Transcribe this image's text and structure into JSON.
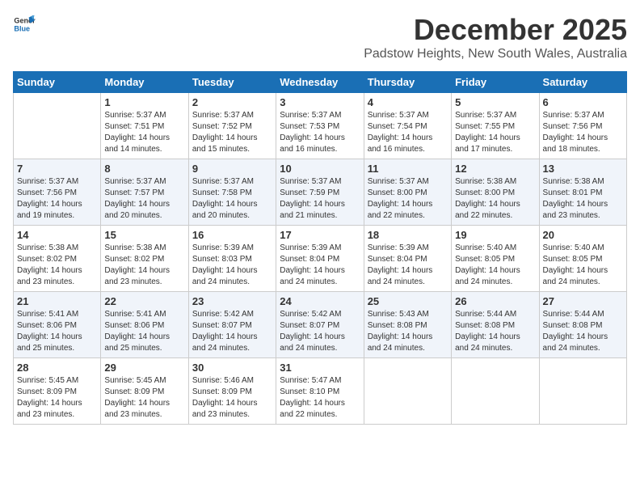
{
  "header": {
    "logo_general": "General",
    "logo_blue": "Blue",
    "title": "December 2025",
    "subtitle": "Padstow Heights, New South Wales, Australia"
  },
  "days_of_week": [
    "Sunday",
    "Monday",
    "Tuesday",
    "Wednesday",
    "Thursday",
    "Friday",
    "Saturday"
  ],
  "weeks": [
    [
      {
        "day": "",
        "info": ""
      },
      {
        "day": "1",
        "info": "Sunrise: 5:37 AM\nSunset: 7:51 PM\nDaylight: 14 hours\nand 14 minutes."
      },
      {
        "day": "2",
        "info": "Sunrise: 5:37 AM\nSunset: 7:52 PM\nDaylight: 14 hours\nand 15 minutes."
      },
      {
        "day": "3",
        "info": "Sunrise: 5:37 AM\nSunset: 7:53 PM\nDaylight: 14 hours\nand 16 minutes."
      },
      {
        "day": "4",
        "info": "Sunrise: 5:37 AM\nSunset: 7:54 PM\nDaylight: 14 hours\nand 16 minutes."
      },
      {
        "day": "5",
        "info": "Sunrise: 5:37 AM\nSunset: 7:55 PM\nDaylight: 14 hours\nand 17 minutes."
      },
      {
        "day": "6",
        "info": "Sunrise: 5:37 AM\nSunset: 7:56 PM\nDaylight: 14 hours\nand 18 minutes."
      }
    ],
    [
      {
        "day": "7",
        "info": "Sunrise: 5:37 AM\nSunset: 7:56 PM\nDaylight: 14 hours\nand 19 minutes."
      },
      {
        "day": "8",
        "info": "Sunrise: 5:37 AM\nSunset: 7:57 PM\nDaylight: 14 hours\nand 20 minutes."
      },
      {
        "day": "9",
        "info": "Sunrise: 5:37 AM\nSunset: 7:58 PM\nDaylight: 14 hours\nand 20 minutes."
      },
      {
        "day": "10",
        "info": "Sunrise: 5:37 AM\nSunset: 7:59 PM\nDaylight: 14 hours\nand 21 minutes."
      },
      {
        "day": "11",
        "info": "Sunrise: 5:37 AM\nSunset: 8:00 PM\nDaylight: 14 hours\nand 22 minutes."
      },
      {
        "day": "12",
        "info": "Sunrise: 5:38 AM\nSunset: 8:00 PM\nDaylight: 14 hours\nand 22 minutes."
      },
      {
        "day": "13",
        "info": "Sunrise: 5:38 AM\nSunset: 8:01 PM\nDaylight: 14 hours\nand 23 minutes."
      }
    ],
    [
      {
        "day": "14",
        "info": "Sunrise: 5:38 AM\nSunset: 8:02 PM\nDaylight: 14 hours\nand 23 minutes."
      },
      {
        "day": "15",
        "info": "Sunrise: 5:38 AM\nSunset: 8:02 PM\nDaylight: 14 hours\nand 23 minutes."
      },
      {
        "day": "16",
        "info": "Sunrise: 5:39 AM\nSunset: 8:03 PM\nDaylight: 14 hours\nand 24 minutes."
      },
      {
        "day": "17",
        "info": "Sunrise: 5:39 AM\nSunset: 8:04 PM\nDaylight: 14 hours\nand 24 minutes."
      },
      {
        "day": "18",
        "info": "Sunrise: 5:39 AM\nSunset: 8:04 PM\nDaylight: 14 hours\nand 24 minutes."
      },
      {
        "day": "19",
        "info": "Sunrise: 5:40 AM\nSunset: 8:05 PM\nDaylight: 14 hours\nand 24 minutes."
      },
      {
        "day": "20",
        "info": "Sunrise: 5:40 AM\nSunset: 8:05 PM\nDaylight: 14 hours\nand 24 minutes."
      }
    ],
    [
      {
        "day": "21",
        "info": "Sunrise: 5:41 AM\nSunset: 8:06 PM\nDaylight: 14 hours\nand 25 minutes."
      },
      {
        "day": "22",
        "info": "Sunrise: 5:41 AM\nSunset: 8:06 PM\nDaylight: 14 hours\nand 25 minutes."
      },
      {
        "day": "23",
        "info": "Sunrise: 5:42 AM\nSunset: 8:07 PM\nDaylight: 14 hours\nand 24 minutes."
      },
      {
        "day": "24",
        "info": "Sunrise: 5:42 AM\nSunset: 8:07 PM\nDaylight: 14 hours\nand 24 minutes."
      },
      {
        "day": "25",
        "info": "Sunrise: 5:43 AM\nSunset: 8:08 PM\nDaylight: 14 hours\nand 24 minutes."
      },
      {
        "day": "26",
        "info": "Sunrise: 5:44 AM\nSunset: 8:08 PM\nDaylight: 14 hours\nand 24 minutes."
      },
      {
        "day": "27",
        "info": "Sunrise: 5:44 AM\nSunset: 8:08 PM\nDaylight: 14 hours\nand 24 minutes."
      }
    ],
    [
      {
        "day": "28",
        "info": "Sunrise: 5:45 AM\nSunset: 8:09 PM\nDaylight: 14 hours\nand 23 minutes."
      },
      {
        "day": "29",
        "info": "Sunrise: 5:45 AM\nSunset: 8:09 PM\nDaylight: 14 hours\nand 23 minutes."
      },
      {
        "day": "30",
        "info": "Sunrise: 5:46 AM\nSunset: 8:09 PM\nDaylight: 14 hours\nand 23 minutes."
      },
      {
        "day": "31",
        "info": "Sunrise: 5:47 AM\nSunset: 8:10 PM\nDaylight: 14 hours\nand 22 minutes."
      },
      {
        "day": "",
        "info": ""
      },
      {
        "day": "",
        "info": ""
      },
      {
        "day": "",
        "info": ""
      }
    ]
  ]
}
